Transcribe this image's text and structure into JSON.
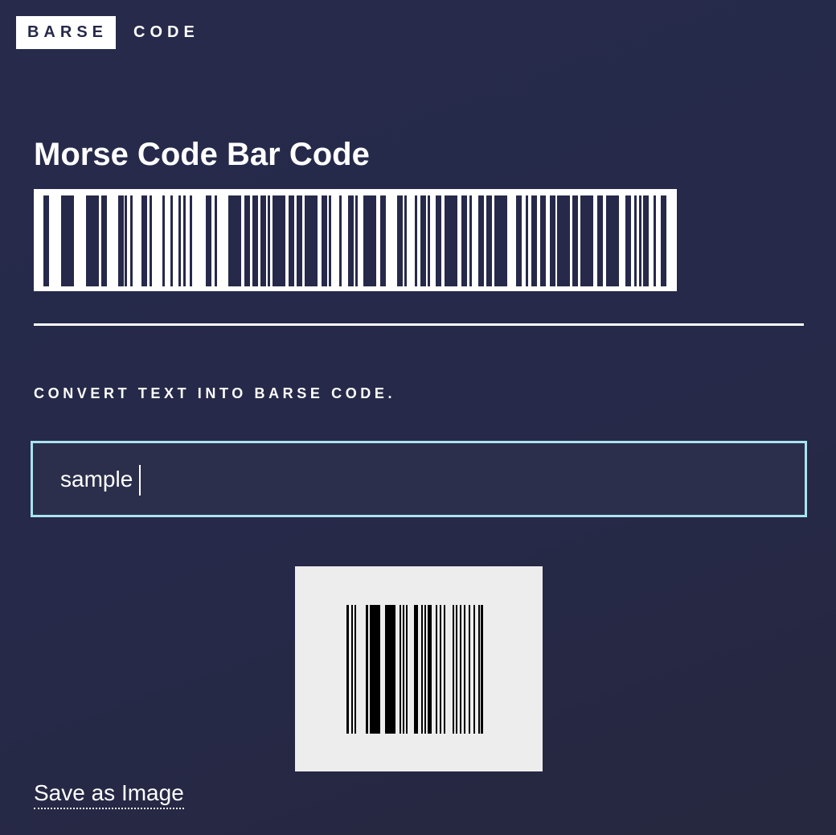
{
  "header": {
    "logo_box_text": "BARSE",
    "logo_text": "CODE"
  },
  "main": {
    "title": "Morse Code Bar Code",
    "section_label": "CONVERT TEXT INTO BARSE CODE.",
    "input_value": "sample",
    "save_link": "Save as Image"
  },
  "colors": {
    "background": "#262949",
    "input_border": "#a8e4f0",
    "result_card": "#ededed"
  }
}
